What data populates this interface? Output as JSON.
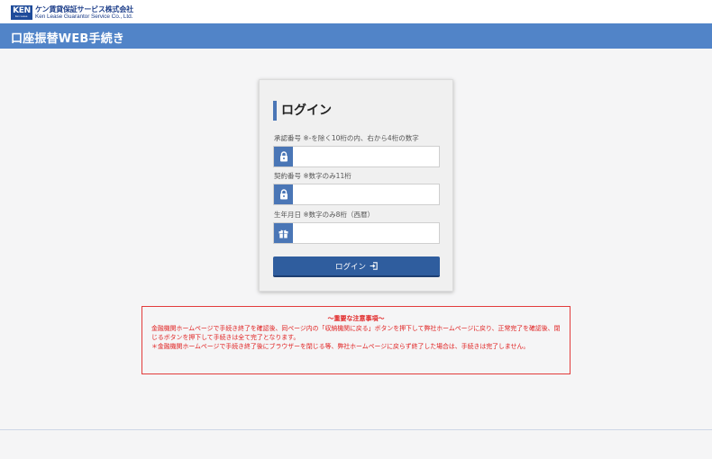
{
  "header": {
    "logo_mark": "KEN",
    "logo_mark_sub": "Ken Lease",
    "company_jp": "ケン賃貸保証サービス株式会社",
    "company_en": "Ken Lease Guarantor Service Co., Ltd."
  },
  "titlebar": {
    "title": "口座振替WEB手続き"
  },
  "login": {
    "title": "ログイン",
    "fields": [
      {
        "label": "承認番号 ※-を除く10桁の内、右から4桁の数字",
        "value": "",
        "placeholder": "",
        "icon": "lock-icon"
      },
      {
        "label": "契約番号 ※数字のみ11桁",
        "value": "",
        "placeholder": "",
        "icon": "lock-icon"
      },
      {
        "label": "生年月日 ※数字のみ8桁（西暦）",
        "value": "",
        "placeholder": "",
        "icon": "gift-icon"
      }
    ],
    "button_label": "ログイン",
    "button_icon": "login-icon"
  },
  "notice": {
    "title": "～重要な注意事項～",
    "line1": "金融機関ホームページで手続き終了を確認後、同ページ内の「収納機関に戻る」ボタンを押下して弊社ホームページに戻り、正常完了を確認後、閉じるボタンを押下して手続きは全て完了となります。",
    "line2": "＊金融機関ホームページで手続き終了後にブラウザーを閉じる等、弊社ホームページに戻らず終了した場合は、手続きは完了しません。"
  },
  "colors": {
    "titlebar": "#5184c8",
    "accent": "#4a76b6",
    "button": "#2f5d9e",
    "notice_red": "#e01e1e"
  }
}
